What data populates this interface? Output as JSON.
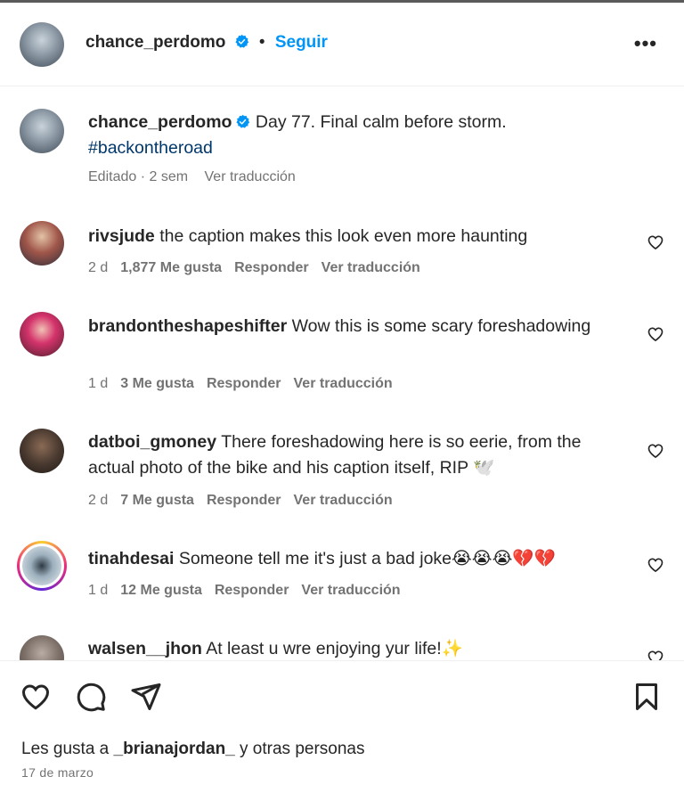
{
  "header": {
    "username": "chance_perdomo",
    "separator": "•",
    "follow_label": "Seguir",
    "more_label": "•••"
  },
  "caption": {
    "username": "chance_perdomo",
    "text": "Day 77. Final calm before storm.",
    "hashtag": "#backontheroad",
    "edited": "Editado · 2 sem",
    "translate": "Ver traducción"
  },
  "comments": [
    {
      "username": "rivsjude",
      "text": "the caption makes this look even more haunting",
      "time": "2 d",
      "likes": "1,877 Me gusta",
      "reply": "Responder",
      "translate": "Ver traducción"
    },
    {
      "username": "brandontheshapeshifter",
      "text": "Wow this is some scary foreshadowing",
      "time": "1 d",
      "likes": "3 Me gusta",
      "reply": "Responder",
      "translate": "Ver traducción"
    },
    {
      "username": "datboi_gmoney",
      "text": "There foreshadowing here is so eerie, from the actual photo of the bike and his caption itself, RIP 🕊️",
      "time": "2 d",
      "likes": "7 Me gusta",
      "reply": "Responder",
      "translate": "Ver traducción"
    },
    {
      "username": "tinahdesai",
      "text": "Someone tell me it's just a bad joke😭😭😭💔💔",
      "time": "1 d",
      "likes": "12 Me gusta",
      "reply": "Responder",
      "translate": "Ver traducción"
    },
    {
      "username": "walsen__jhon",
      "text": "At least u wre enjoying yur life!✨"
    }
  ],
  "footer": {
    "likes_prefix": "Les gusta a ",
    "likes_user": "_brianajordan_",
    "likes_suffix": " y otras personas",
    "date": "17 de marzo"
  },
  "icons": {
    "like": "heart-icon",
    "comment": "comment-icon",
    "share": "share-icon",
    "save": "bookmark-icon",
    "verified": "verified-badge-icon"
  },
  "colors": {
    "accent": "#0095f6",
    "hashtag": "#00376b",
    "secondary_text": "#737373",
    "primary_text": "#262626"
  }
}
